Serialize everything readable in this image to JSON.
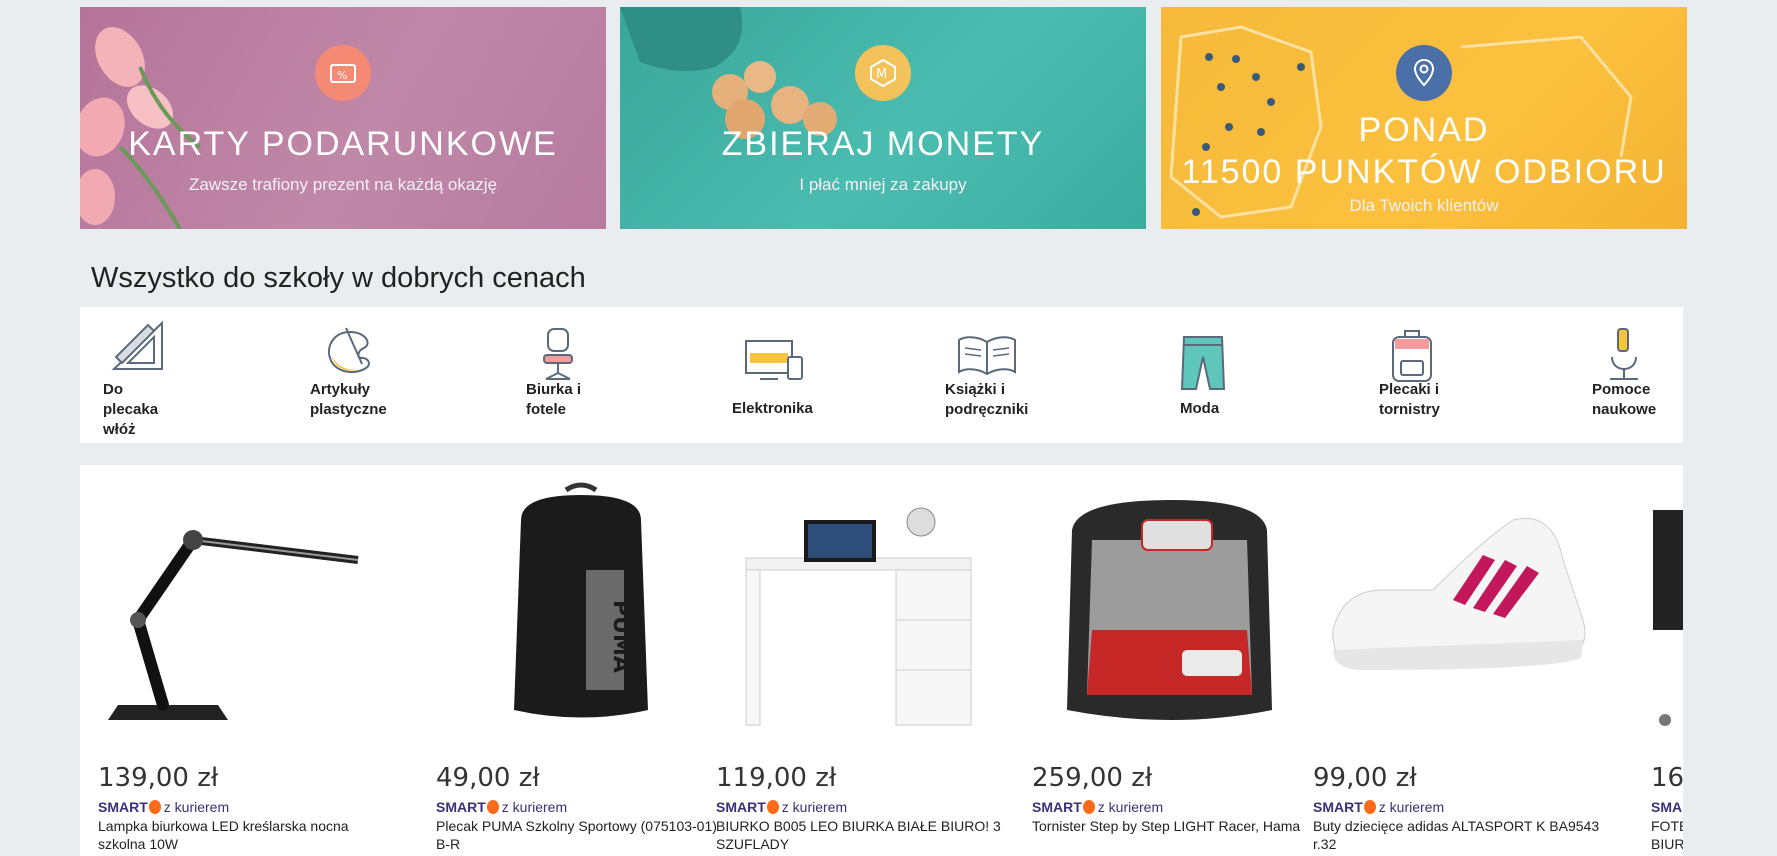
{
  "banners": [
    {
      "title": "KARTY PODARUNKOWE",
      "subtitle": "Zawsze trafiony prezent na każdą okazję",
      "icon": "gift-card-percent-icon"
    },
    {
      "title": "ZBIERAJ MONETY",
      "subtitle": "I płać mniej za zakupy",
      "icon": "coin-m-icon"
    },
    {
      "title_line1": "PONAD",
      "title_line2": "11500 PUNKTÓW ODBIORU",
      "subtitle": "Dla Twoich klientów",
      "icon": "location-pin-icon"
    }
  ],
  "section": {
    "title": "Wszystko do szkoły w dobrych cenach"
  },
  "categories": [
    {
      "label": "Do\nplecaka\nwłóż",
      "icon": "ruler-pencil-icon"
    },
    {
      "label": "Artykuły\nplastyczne",
      "icon": "paint-palette-icon"
    },
    {
      "label": "Biurka i\nfotele",
      "icon": "office-chair-icon"
    },
    {
      "label": "Elektronika",
      "icon": "computer-devices-icon"
    },
    {
      "label": "Książki i\npodręczniki",
      "icon": "open-book-icon"
    },
    {
      "label": "Moda",
      "icon": "pants-icon"
    },
    {
      "label": "Plecaki i\ntornistry",
      "icon": "backpack-icon"
    },
    {
      "label": "Pomoce\nnaukowe",
      "icon": "microscope-icon"
    }
  ],
  "products": [
    {
      "price": "139,00 zł",
      "smart": "SMART",
      "delivery": "z kurierem",
      "name": "Lampka biurkowa LED kreślarska nocna szkolna 10W"
    },
    {
      "price": "49,00 zł",
      "smart": "SMART",
      "delivery": "z kurierem",
      "name": "Plecak PUMA Szkolny Sportowy (075103-01) B-R"
    },
    {
      "price": "119,00 zł",
      "smart": "SMART",
      "delivery": "z kurierem",
      "name": "BIURKO B005 LEO BIURKA BIAŁE BIURO! 3 SZUFLADY"
    },
    {
      "price": "259,00 zł",
      "smart": "SMART",
      "delivery": "z kurierem",
      "name": "Tornister Step by Step LIGHT Racer, Hama"
    },
    {
      "price": "99,00 zł",
      "smart": "SMART",
      "delivery": "z kurierem",
      "name": "Buty dziecięce adidas ALTASPORT K BA9543 r.32"
    },
    {
      "price": "16",
      "smart": "SMAR",
      "delivery": "",
      "name": "FOTE BIUR"
    }
  ],
  "colors": {
    "accent_smart": "#3d2f7a",
    "smart_dot": "#ff6a1a",
    "banner_pink": "#b5749a",
    "banner_teal": "#3aa79a",
    "banner_yellow": "#f6b93a"
  }
}
